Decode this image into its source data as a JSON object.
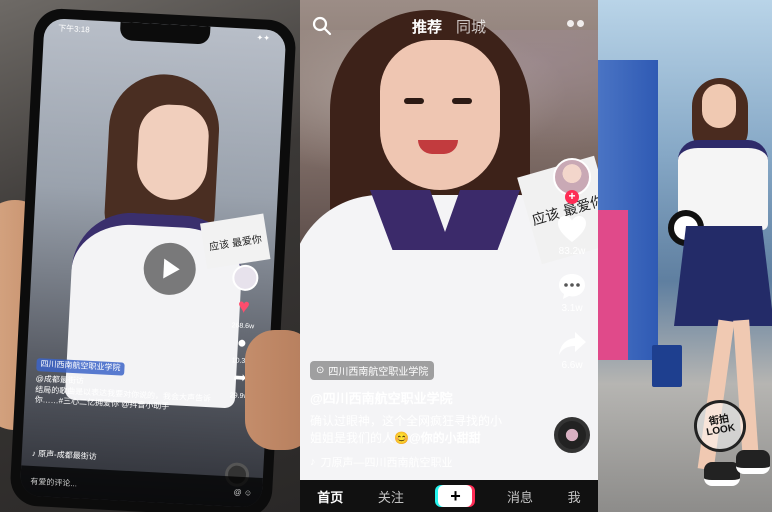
{
  "left_phone": {
    "status_time": "下午3:18",
    "status_right": "✦✦",
    "sign_text": "应该\n最爱你",
    "likes": "268.6w",
    "comments": "10.3w",
    "shares": "29.9w",
    "caption_tag": "四川西南航空职业学院",
    "author": "@成都最街访",
    "desc": "结局的歌曲是以表达我要对你说的，我会大声告诉你……#三心二亿拥爱你 @抖音小助手",
    "music": "♪ 原声-成都最街访",
    "bottom_left": "有爱的评论...",
    "bottom_right": "@ ☺"
  },
  "app": {
    "tabs": {
      "recommend": "推荐",
      "local": "同城"
    },
    "rail": {
      "likes": "83.2w",
      "comments": "3.1w",
      "shares": "6.6w",
      "follow_symbol": "+"
    },
    "sign_text": "应该\n最爱你",
    "location": "四川西南航空职业学院",
    "author": "@四川西南航空职业学院",
    "desc_line1": "确认过眼神，这个全网疯狂寻找的小",
    "desc_line2": "姐姐是我们的人",
    "desc_emoji": "😊",
    "desc_mention": "@你的小甜甜",
    "music": "刀原声—四川西南航空职业",
    "nav": {
      "home": "首页",
      "follow": "关注",
      "add": "+",
      "messages": "消息",
      "me": "我"
    }
  },
  "right_photo": {
    "stamp": "街拍LOOK"
  },
  "colors": {
    "brand_red": "#fe2c55",
    "brand_cyan": "#25f4ee",
    "uniform_navy": "#2e2b6a"
  }
}
